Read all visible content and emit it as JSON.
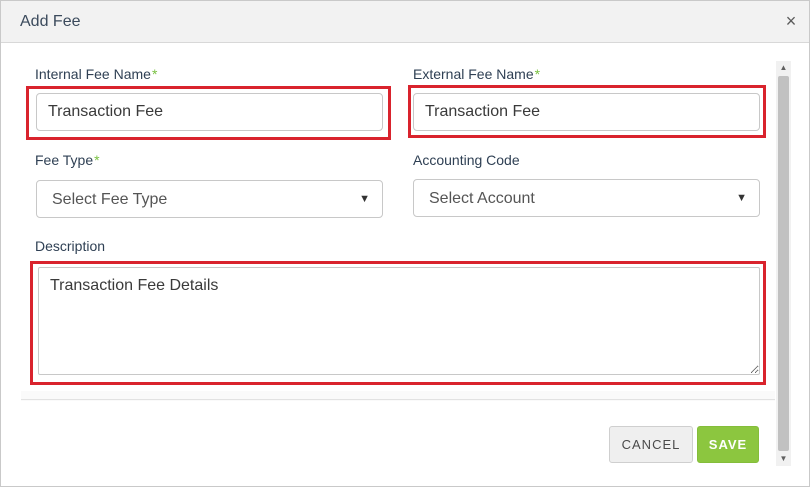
{
  "dialog": {
    "title": "Add Fee",
    "close_glyph": "×"
  },
  "form": {
    "internal_fee_name": {
      "label": "Internal Fee Name",
      "required_mark": "*",
      "value": "Transaction Fee"
    },
    "external_fee_name": {
      "label": "External Fee Name",
      "required_mark": "*",
      "value": "Transaction Fee"
    },
    "fee_type": {
      "label": "Fee Type",
      "required_mark": "*",
      "selected": "Select Fee Type"
    },
    "accounting_code": {
      "label": "Accounting Code",
      "selected": "Select Account"
    },
    "description": {
      "label": "Description",
      "value": "Transaction Fee Details"
    }
  },
  "footer": {
    "cancel_label": "CANCEL",
    "save_label": "SAVE"
  },
  "icons": {
    "caret": "▼",
    "scroll_up": "▲",
    "scroll_down": "▼"
  },
  "colors": {
    "required": "#7ac143",
    "highlight": "#d9232d",
    "save_button": "#8cc63f"
  }
}
